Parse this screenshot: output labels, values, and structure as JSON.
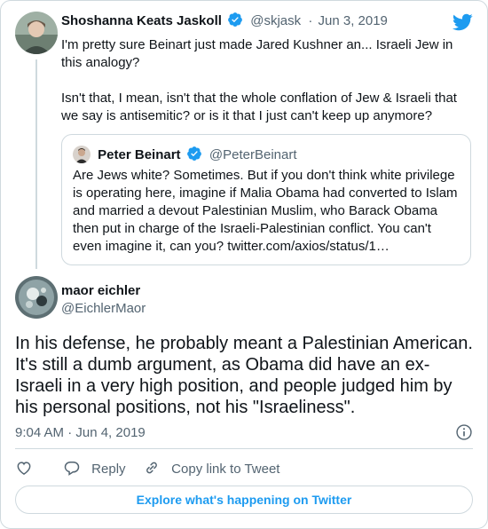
{
  "colors": {
    "accent": "#1d9bf0",
    "muted": "#536471",
    "border": "#cfd9de",
    "text": "#0f1419"
  },
  "parent_tweet": {
    "author_name": "Shoshanna Keats Jaskoll",
    "handle": "@skjask",
    "date": "Jun 3, 2019",
    "text": "I'm pretty sure Beinart just made Jared Kushner an... Israeli Jew in this analogy?\n\nIsn't that, I mean, isn't that the whole conflation of Jew & Israeli that we say is antisemitic? or is it that I just can't keep up anymore?",
    "icons": [
      "verified-badge-icon",
      "twitter-bird-icon"
    ]
  },
  "quoted_tweet": {
    "author_name": "Peter Beinart",
    "handle": "@PeterBeinart",
    "text": "Are Jews white? Sometimes. But if you don't think white privilege is operating here, imagine if Malia Obama had converted to Islam and married a devout Palestinian Muslim, who Barack Obama then put in charge of the Israeli-Palestinian conflict. You can't even imagine it, can you? twitter.com/axios/status/1…"
  },
  "main_tweet": {
    "author_name": "maor eichler",
    "handle": "@EichlerMaor",
    "text": "In his defense, he probably meant a Palestinian American. It's still a dumb argument, as Obama did have an ex-Israeli in a very high position, and people judged him by his personal positions, not his \"Israeliness\".",
    "timestamp": "9:04 AM · Jun 4, 2019"
  },
  "actions": {
    "like_icon": "heart-icon",
    "reply_label": "Reply",
    "copy_link_label": "Copy link to Tweet"
  },
  "explore_label": "Explore what's happening on Twitter"
}
